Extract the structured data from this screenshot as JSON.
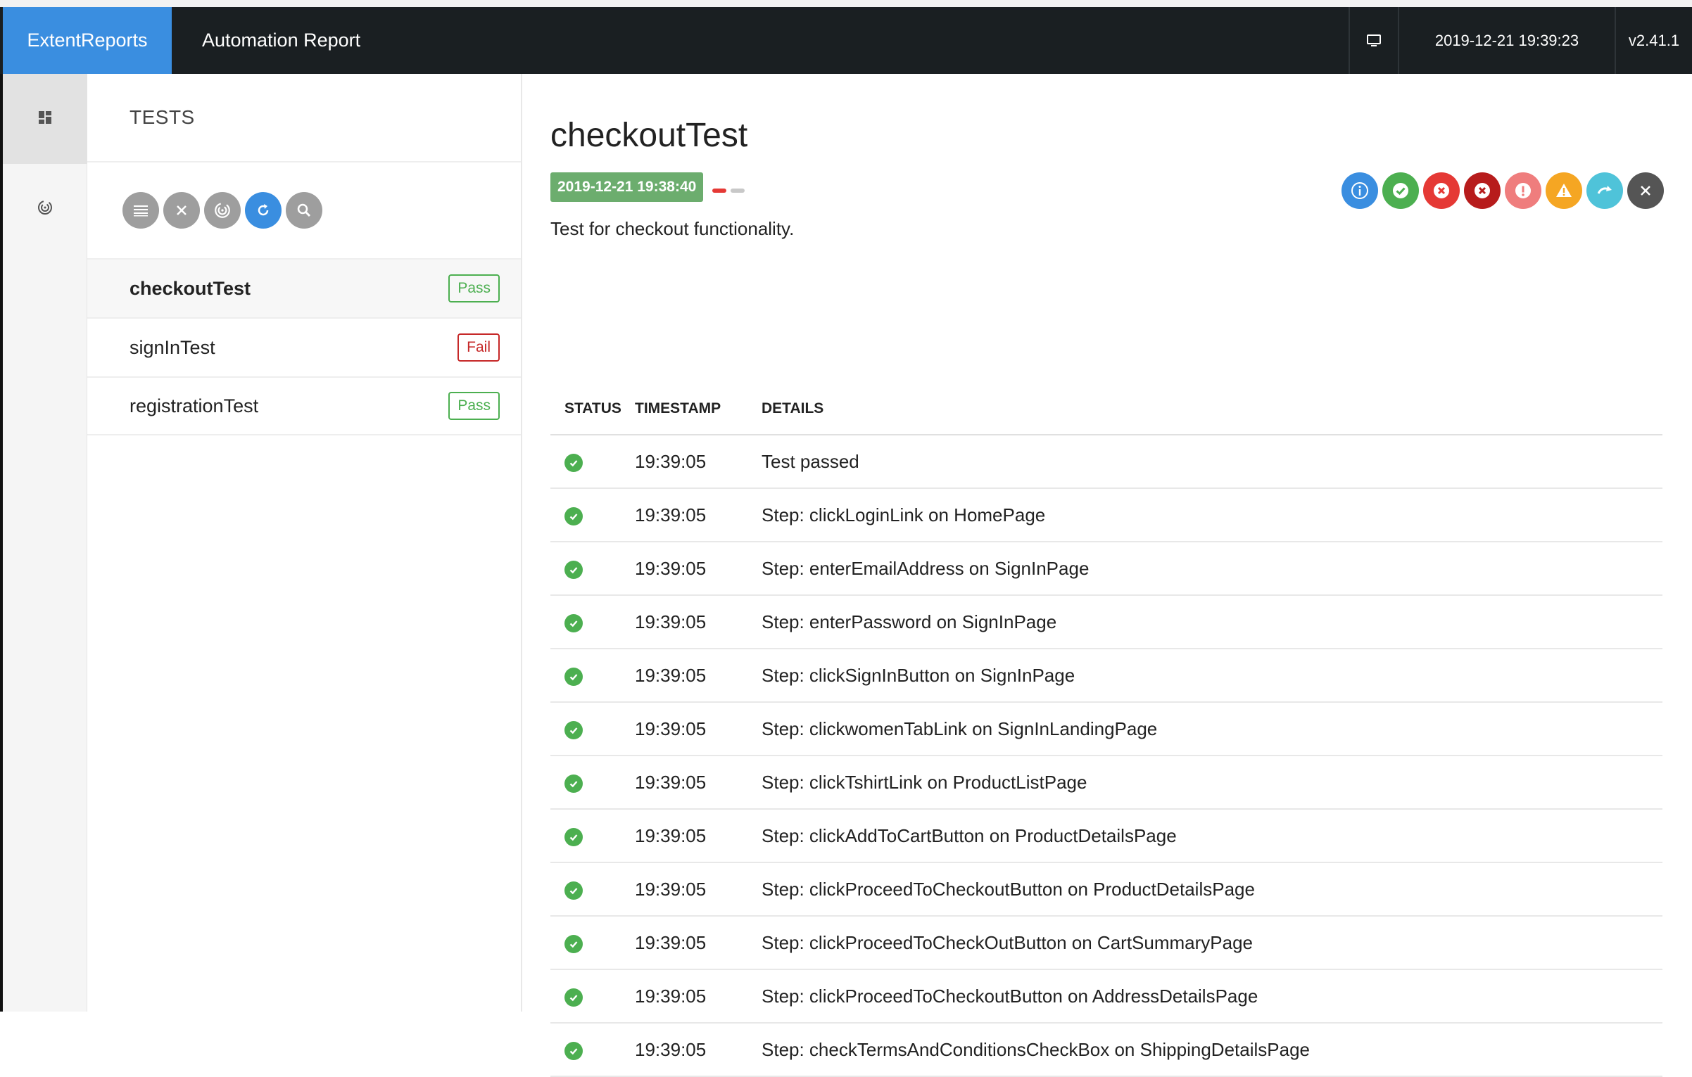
{
  "header": {
    "brand": "ExtentReports",
    "report_name": "Automation Report",
    "datetime": "2019-12-21 19:39:23",
    "version": "v2.41.1",
    "monitor_icon": "monitor-icon"
  },
  "leftnav": {
    "items": [
      {
        "icon": "dashboard-icon",
        "active": true
      },
      {
        "icon": "fingerprint-icon",
        "active": false
      }
    ]
  },
  "tests_panel": {
    "title": "TESTS",
    "filters": [
      "list-icon",
      "close-icon",
      "fingerprint-icon",
      "refresh-icon",
      "search-icon"
    ],
    "tests": [
      {
        "name": "checkoutTest",
        "status": "Pass"
      },
      {
        "name": "signInTest",
        "status": "Fail"
      },
      {
        "name": "registrationTest",
        "status": "Pass"
      }
    ]
  },
  "test_detail": {
    "name": "checkoutTest",
    "start_time": "2019-12-21 19:38:40",
    "description": "Test for checkout functionality.",
    "status_filters": [
      {
        "icon": "info-icon",
        "color": "#3a8ee0"
      },
      {
        "icon": "pass-icon",
        "color": "#4caf50"
      },
      {
        "icon": "fail-icon",
        "color": "#e53935"
      },
      {
        "icon": "fatal-icon",
        "color": "#b71c1c"
      },
      {
        "icon": "error-icon",
        "color": "#ef7d7d"
      },
      {
        "icon": "warning-icon",
        "color": "#f5a623"
      },
      {
        "icon": "skip-icon",
        "color": "#4fc3d9"
      },
      {
        "icon": "clear-icon",
        "color": "#555555"
      }
    ],
    "columns": [
      "STATUS",
      "TIMESTAMP",
      "DETAILS"
    ],
    "logs": [
      {
        "timestamp": "19:39:05",
        "details": "Test passed"
      },
      {
        "timestamp": "19:39:05",
        "details": "Step: clickLoginLink on HomePage"
      },
      {
        "timestamp": "19:39:05",
        "details": "Step: enterEmailAddress on SignInPage"
      },
      {
        "timestamp": "19:39:05",
        "details": "Step: enterPassword on SignInPage"
      },
      {
        "timestamp": "19:39:05",
        "details": "Step: clickSignInButton on SignInPage"
      },
      {
        "timestamp": "19:39:05",
        "details": "Step: clickwomenTabLink on SignInLandingPage"
      },
      {
        "timestamp": "19:39:05",
        "details": "Step: clickTshirtLink on ProductListPage"
      },
      {
        "timestamp": "19:39:05",
        "details": "Step: clickAddToCartButton on ProductDetailsPage"
      },
      {
        "timestamp": "19:39:05",
        "details": "Step: clickProceedToCheckoutButton on ProductDetailsPage"
      },
      {
        "timestamp": "19:39:05",
        "details": "Step: clickProceedToCheckOutButton on CartSummaryPage"
      },
      {
        "timestamp": "19:39:05",
        "details": "Step: clickProceedToCheckoutButton on AddressDetailsPage"
      },
      {
        "timestamp": "19:39:05",
        "details": "Step: checkTermsAndConditionsCheckBox on ShippingDetailsPage"
      }
    ]
  },
  "colors": {
    "brand": "#3a8ee0",
    "topbar": "#1a1f22",
    "pass": "#4caf50",
    "fail": "#c62828"
  }
}
